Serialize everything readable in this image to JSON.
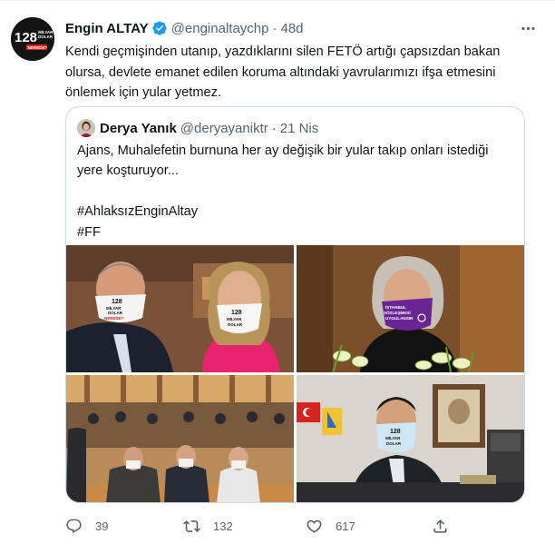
{
  "tweet": {
    "author_name": "Engin ALTAY",
    "author_handle": "@enginaltaychp",
    "separator": "·",
    "time": "48d",
    "more_label": "···",
    "avatar_text_top": "128",
    "avatar_text_mid": "MİLYAR",
    "avatar_text_low": "DOLAR",
    "avatar_text_bottom": "NEREDE?",
    "text": "Kendi geçmişinden utanıp, yazdıklarını silen FETÖ artığı çapsızdan bakan olursa, devlete emanet edilen koruma altındaki yavrularımızı ifşa etmesini önlemek için yular yetmez."
  },
  "quote": {
    "author_name": "Derya Yanık",
    "author_handle": "@deryayaniktr",
    "separator": "·",
    "time": "21 Nis",
    "text": "Ajans, Muhalefetin burnuna her ay değişik bir yular takıp onları istediği yere koşturuyor...",
    "hashtag_1": "#AhlaksızEnginAltay",
    "hashtag_2": "#FF",
    "mask_text_1": "128",
    "mask_text_2": "MİLYAR",
    "mask_text_3": "DOLAR",
    "mask_text_4": "NEREDE?",
    "mask_text_purple_1": "İSTANBUL",
    "mask_text_purple_2": "SÖZLEŞMESİ",
    "mask_text_purple_3": "UYGULANSIN"
  },
  "actions": {
    "reply_count": "39",
    "retweet_count": "132",
    "like_count": "617"
  },
  "colors": {
    "text_primary": "#0f1419",
    "text_secondary": "#536471",
    "verified_blue": "#1d9bf0",
    "border": "#cfd9de"
  }
}
